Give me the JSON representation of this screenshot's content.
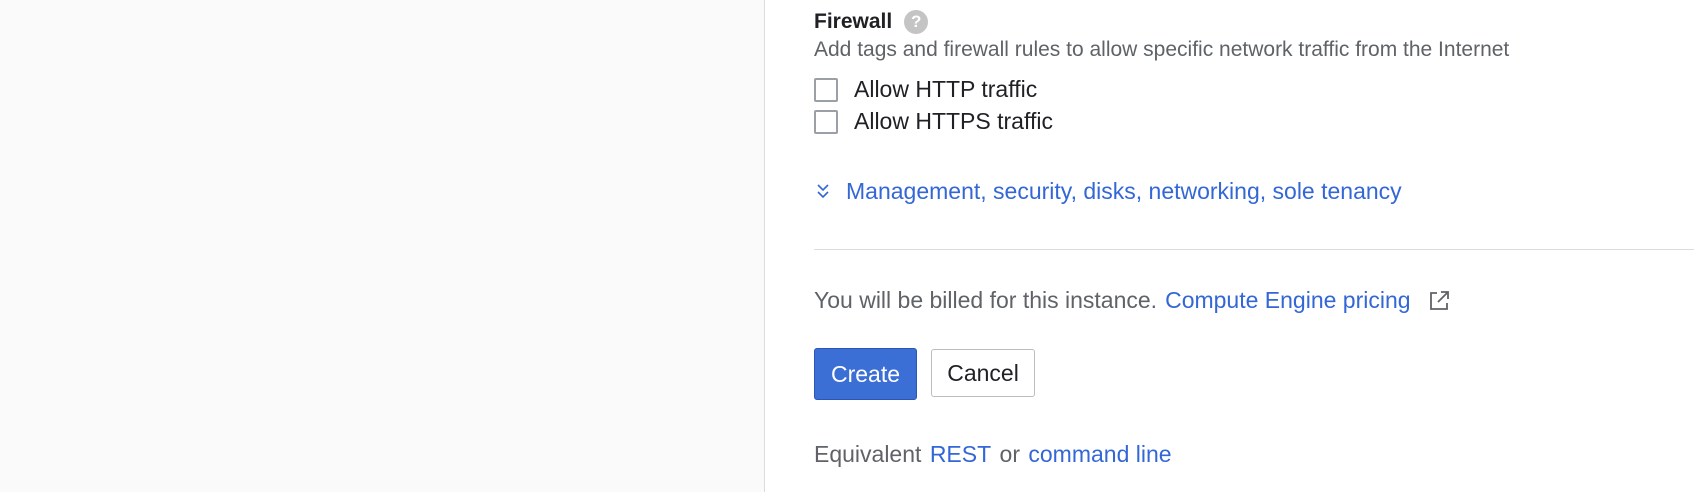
{
  "firewall": {
    "title": "Firewall",
    "help_icon": "?",
    "description": "Add tags and firewall rules to allow specific network traffic from the Internet",
    "options": [
      {
        "label": "Allow HTTP traffic",
        "checked": false
      },
      {
        "label": "Allow HTTPS traffic",
        "checked": false
      }
    ]
  },
  "expander": {
    "label": "Management, security, disks, networking, sole tenancy",
    "icon": "chevron-down-icon"
  },
  "billing": {
    "text": "You will be billed for this instance.",
    "link_label": "Compute Engine pricing",
    "icon": "external-link-icon"
  },
  "actions": {
    "create_label": "Create",
    "cancel_label": "Cancel"
  },
  "equivalent": {
    "prefix": "Equivalent",
    "rest_label": "REST",
    "or_text": "or",
    "command_line_label": "command line"
  },
  "colors": {
    "link": "#3367d6",
    "primary_button": "#3b6fd6",
    "left_pane_bg": "#fafafa"
  }
}
